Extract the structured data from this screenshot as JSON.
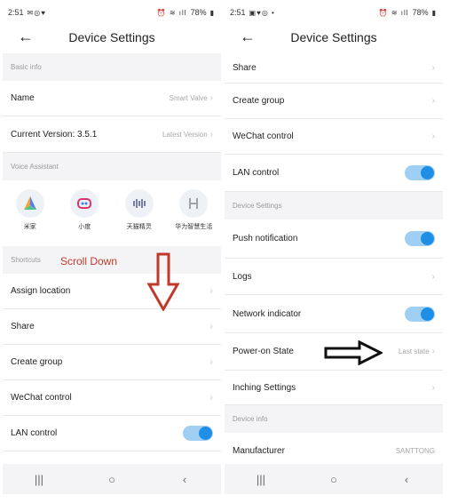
{
  "left": {
    "status": {
      "time": "2:51",
      "battery": "78%"
    },
    "title": "Device Settings",
    "sections": {
      "basic_info": "Basic info",
      "voice_assistant": "Voice Assistant",
      "shortcuts": "Shortcuts"
    },
    "name_row": {
      "label": "Name",
      "value": "Smart Valve"
    },
    "version_row": {
      "label": "Current Version:  3.5.1",
      "value": "Latest Version"
    },
    "assistants": [
      {
        "name": "米家",
        "icon": "mi-home-icon"
      },
      {
        "name": "小度",
        "icon": "xiaodu-icon"
      },
      {
        "name": "天猫精灵",
        "icon": "tmall-genie-icon"
      },
      {
        "name": "华为智慧生活",
        "icon": "huawei-smart-life-icon"
      }
    ],
    "shortcut_rows": {
      "assign_location": "Assign location",
      "share": "Share",
      "create_group": "Create group",
      "wechat_control": "WeChat control",
      "lan_control": "LAN control"
    },
    "lan_toggle_on": true
  },
  "right": {
    "status": {
      "time": "2:51",
      "battery": "78%"
    },
    "title": "Device Settings",
    "rows_top": {
      "share": "Share",
      "create_group": "Create group",
      "wechat_control": "WeChat control",
      "lan_control": "LAN control"
    },
    "sections": {
      "device_settings": "Device Settings",
      "device_info": "Device info"
    },
    "device_settings_rows": {
      "push_notification": "Push notification",
      "logs": "Logs",
      "network_indicator": "Network indicator",
      "power_on_state": "Power-on State",
      "power_on_value": "Last state",
      "inching_settings": "Inching Settings"
    },
    "manufacturer": {
      "label": "Manufacturer",
      "value": "SANTTONG"
    },
    "toggles": {
      "lan_control": true,
      "push_notification": true,
      "network_indicator": true
    }
  },
  "annotation": {
    "scroll_text": "Scroll Down",
    "color": "#c0392b"
  },
  "colors": {
    "toggle_track": "#9fd0f3",
    "toggle_knob": "#1f8fe6",
    "section_bg": "#f4f4f6"
  }
}
